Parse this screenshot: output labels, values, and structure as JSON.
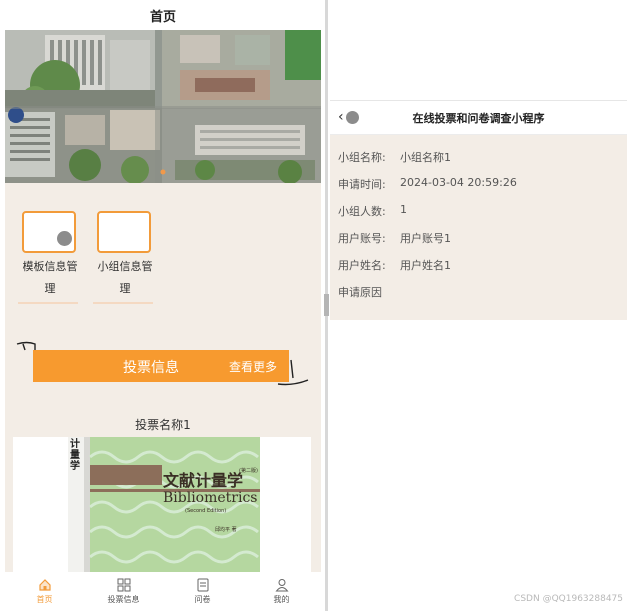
{
  "left": {
    "nav_title": "首页",
    "menu": [
      {
        "label_line1": "模板信息管",
        "label_line2": "理"
      },
      {
        "label_line1": "小组信息管",
        "label_line2": "理"
      }
    ],
    "vote_bar": {
      "title": "投票信息",
      "more": "查看更多"
    },
    "vote_item_name": "投票名称1",
    "book": {
      "title_cn": "文献计量学",
      "edition": "(第二版)",
      "title_en": "Bibliometrics",
      "edition_en": "(Second Edition)",
      "author": "邱均平 著",
      "spine_text": "计量学"
    },
    "tabs": [
      {
        "label": "首页",
        "icon": "home-icon"
      },
      {
        "label": "投票信息",
        "icon": "grid-icon"
      },
      {
        "label": "问卷",
        "icon": "document-icon"
      },
      {
        "label": "我的",
        "icon": "user-icon"
      }
    ],
    "accent": "#f79a2f"
  },
  "right": {
    "nav_title": "在线投票和问卷调查小程序",
    "details": [
      {
        "key": "小组名称:",
        "value": "小组名称1"
      },
      {
        "key": "申请时间:",
        "value": "2024-03-04 20:59:26"
      },
      {
        "key": "小组人数:",
        "value": "1"
      },
      {
        "key": "用户账号:",
        "value": "用户账号1"
      },
      {
        "key": "用户姓名:",
        "value": "用户姓名1"
      },
      {
        "key": "申请原因",
        "value": ""
      }
    ]
  },
  "watermark": "CSDN @QQ1963288475"
}
